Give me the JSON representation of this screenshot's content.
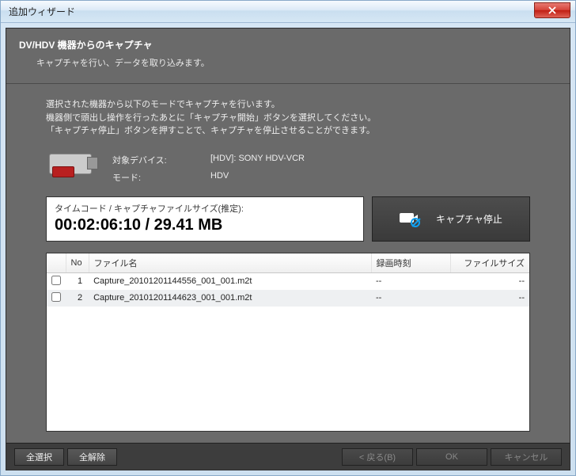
{
  "window": {
    "title": "追加ウィザード"
  },
  "panel": {
    "title": "DV/HDV 機器からのキャプチャ",
    "subtitle": "キャプチャを行い、データを取り込みます。"
  },
  "instructions": {
    "line1": "選択された機器から以下のモードでキャプチャを行います。",
    "line2": "機器側で頭出し操作を行ったあとに「キャプチャ開始」ボタンを選択してください。",
    "line3": "「キャプチャ停止」ボタンを押すことで、キャプチャを停止させることができます。"
  },
  "device": {
    "device_label": "対象デバイス:",
    "device_value": "[HDV]: SONY HDV-VCR",
    "mode_label": "モード:",
    "mode_value": "HDV"
  },
  "timecode": {
    "label": "タイムコード / キャプチャファイルサイズ(推定):",
    "value": "00:02:06:10 / 29.41 MB"
  },
  "capture_button": {
    "label": "キャプチャ停止"
  },
  "table": {
    "headers": {
      "no": "No",
      "filename": "ファイル名",
      "rectime": "録画時刻",
      "filesize": "ファイルサイズ"
    },
    "rows": [
      {
        "no": "1",
        "filename": "Capture_20101201144556_001_001.m2t",
        "rectime": "--",
        "filesize": "--"
      },
      {
        "no": "2",
        "filename": "Capture_20101201144623_001_001.m2t",
        "rectime": "--",
        "filesize": "--"
      }
    ]
  },
  "footer": {
    "select_all": "全選択",
    "deselect_all": "全解除",
    "back": "< 戻る(B)",
    "ok": "OK",
    "cancel": "キャンセル"
  }
}
